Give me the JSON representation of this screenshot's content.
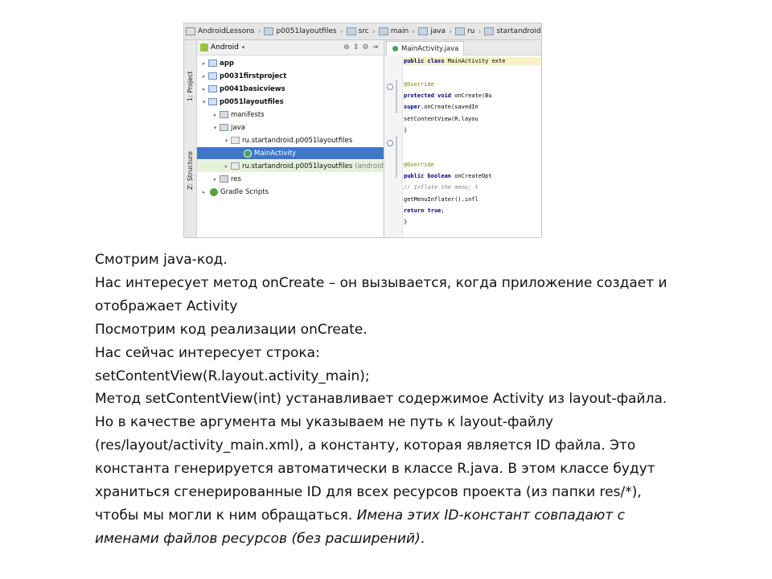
{
  "ide": {
    "breadcrumb": [
      "AndroidLessons",
      "p0051layoutfiles",
      "src",
      "main",
      "java",
      "ru",
      "startandroid"
    ],
    "side_tabs": [
      "1: Project",
      "Z: Structure"
    ],
    "project_view": "Android",
    "tree": [
      {
        "label": "app",
        "level": 0,
        "arrow": "▸",
        "icon": "module",
        "bold": true
      },
      {
        "label": "p0031firstproject",
        "level": 0,
        "arrow": "▸",
        "icon": "module",
        "bold": true
      },
      {
        "label": "p0041basicviews",
        "level": 0,
        "arrow": "▸",
        "icon": "module",
        "bold": true
      },
      {
        "label": "p0051layoutfiles",
        "level": 0,
        "arrow": "▾",
        "icon": "module",
        "bold": true
      },
      {
        "label": "manifests",
        "level": 1,
        "arrow": "▸",
        "icon": "folder"
      },
      {
        "label": "java",
        "level": 1,
        "arrow": "▾",
        "icon": "folder"
      },
      {
        "label": "ru.startandroid.p0051layoutfiles",
        "level": 2,
        "arrow": "▾",
        "icon": "package"
      },
      {
        "label": "MainActivity",
        "level": 3,
        "arrow": "",
        "icon": "class",
        "selected": true
      },
      {
        "label": "ru.startandroid.p0051layoutfiles",
        "note": "(androidTest)",
        "level": 2,
        "arrow": "▸",
        "icon": "package",
        "highlight": true
      },
      {
        "label": "res",
        "level": 1,
        "arrow": "▸",
        "icon": "res"
      },
      {
        "label": "Gradle Scripts",
        "level": 0,
        "arrow": "▸",
        "icon": "gradle"
      }
    ],
    "editor_tab": "MainActivity.java",
    "code_lines": [
      {
        "text": "public class MainActivity exte",
        "cls": "first"
      },
      {
        "text": ""
      },
      {
        "text": "    @Override",
        "cls": "an"
      },
      {
        "text": "    protected void onCreate(Bu"
      },
      {
        "text": "        super.onCreate(savedIn"
      },
      {
        "text": "        setContentView(R.layou"
      },
      {
        "text": "    }"
      },
      {
        "text": ""
      },
      {
        "text": ""
      },
      {
        "text": "    @Override",
        "cls": "an"
      },
      {
        "text": "    public boolean onCreateOpt"
      },
      {
        "text": "        // Inflate the menu; t",
        "cls": "cm"
      },
      {
        "text": "        getMenuInflater().infl"
      },
      {
        "text": "        return true;"
      },
      {
        "text": "    }"
      }
    ]
  },
  "slide": {
    "l1": "Смотрим java-код.",
    "l2": "Нас интересует метод onCreate – он вызывается, когда приложение создает и",
    "l3": "отображает Activity",
    "l4": "Посмотрим код реализации onCreate.",
    "l5": "Нас сейчас интересует строка:",
    "l6": "setContentView(R.layout.activity_main);",
    "l7": "Метод setContentView(int) устанавливает содержимое Activity из layout-файла.",
    "l8": "Но в качестве аргумента мы указываем не путь к layout-файлу",
    "l9": "(res/layout/activity_main.xml), а константу, которая является ID файла. Это",
    "l10": "константа генерируется автоматически в классе R.java. В этом классе будут",
    "l11": "храниться сгенерированные ID для всех ресурсов проекта (из папки res/*),",
    "l12a": "чтобы мы могли к ним обращаться. ",
    "l12b": "Имена этих ID-констант совпадают с",
    "l13": "именами файлов ресурсов (без расширений)",
    "l13end": "."
  }
}
